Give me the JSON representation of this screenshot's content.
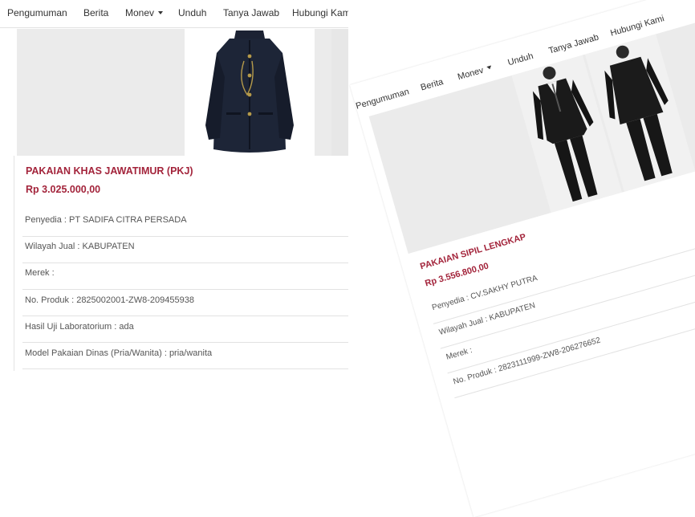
{
  "left": {
    "nav": [
      "Pengumuman",
      "Berita",
      "Monev",
      "Unduh",
      "Tanya Jawab",
      "Hubungi Kami"
    ],
    "product": {
      "title": "PAKAIAN KHAS JAWATIMUR (PKJ)",
      "price": "Rp 3.025.000,00",
      "rows": [
        "Penyedia : PT SADIFA CITRA PERSADA",
        "Wilayah Jual : KABUPATEN",
        "Merek :",
        "No. Produk : 2825002001-ZW8-209455938",
        "Hasil Uji Laboratorium : ada",
        "Model Pakaian Dinas (Pria/Wanita) : pria/wanita"
      ]
    }
  },
  "right": {
    "nav": [
      "Pengumuman",
      "Berita",
      "Monev",
      "Unduh",
      "Tanya Jawab",
      "Hubungi Kami"
    ],
    "product": {
      "title": "PAKAIAN SIPIL LENGKAP",
      "price": "Rp 3.556.800,00",
      "rows": [
        "Penyedia : CV.SAKHY PUTRA",
        "Wilayah Jual : KABUPATEN",
        "Merek :",
        "No. Produk : 2823111999-ZW8-206276652"
      ]
    }
  }
}
